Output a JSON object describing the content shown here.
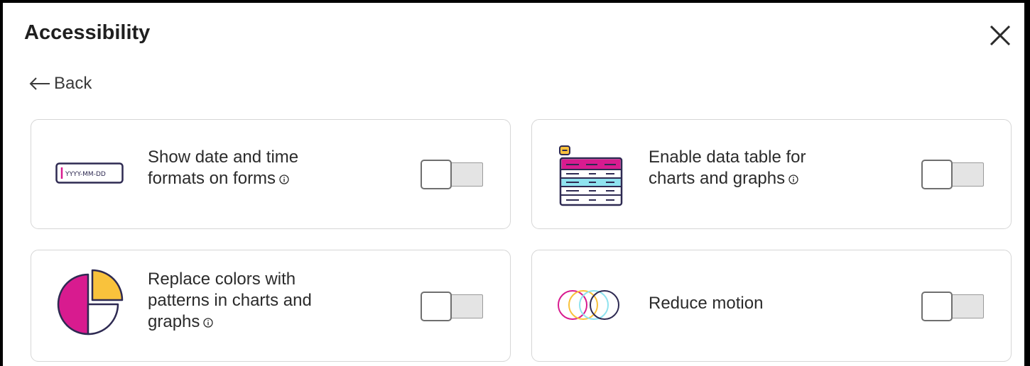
{
  "dialog": {
    "title": "Accessibility",
    "back_label": "Back"
  },
  "settings": [
    {
      "label_lines": [
        "Show date and time",
        "formats on forms"
      ],
      "illustration_text": "YYYY-MM-DD",
      "icon": "date-format-icon",
      "enabled": false
    },
    {
      "label_lines": [
        "Enable data table for",
        "charts and graphs"
      ],
      "icon": "data-table-icon",
      "enabled": false
    },
    {
      "label_lines": [
        "Replace colors with",
        "patterns in charts and",
        "graphs"
      ],
      "icon": "pie-chart-icon",
      "enabled": false
    },
    {
      "label_lines": [
        "Reduce motion"
      ],
      "icon": "overlapping-circles-icon",
      "enabled": false
    }
  ],
  "colors": {
    "magenta": "#d81b8f",
    "cyan": "#8fe3ef",
    "yellow": "#f9c23c",
    "navy": "#2e2a52"
  }
}
